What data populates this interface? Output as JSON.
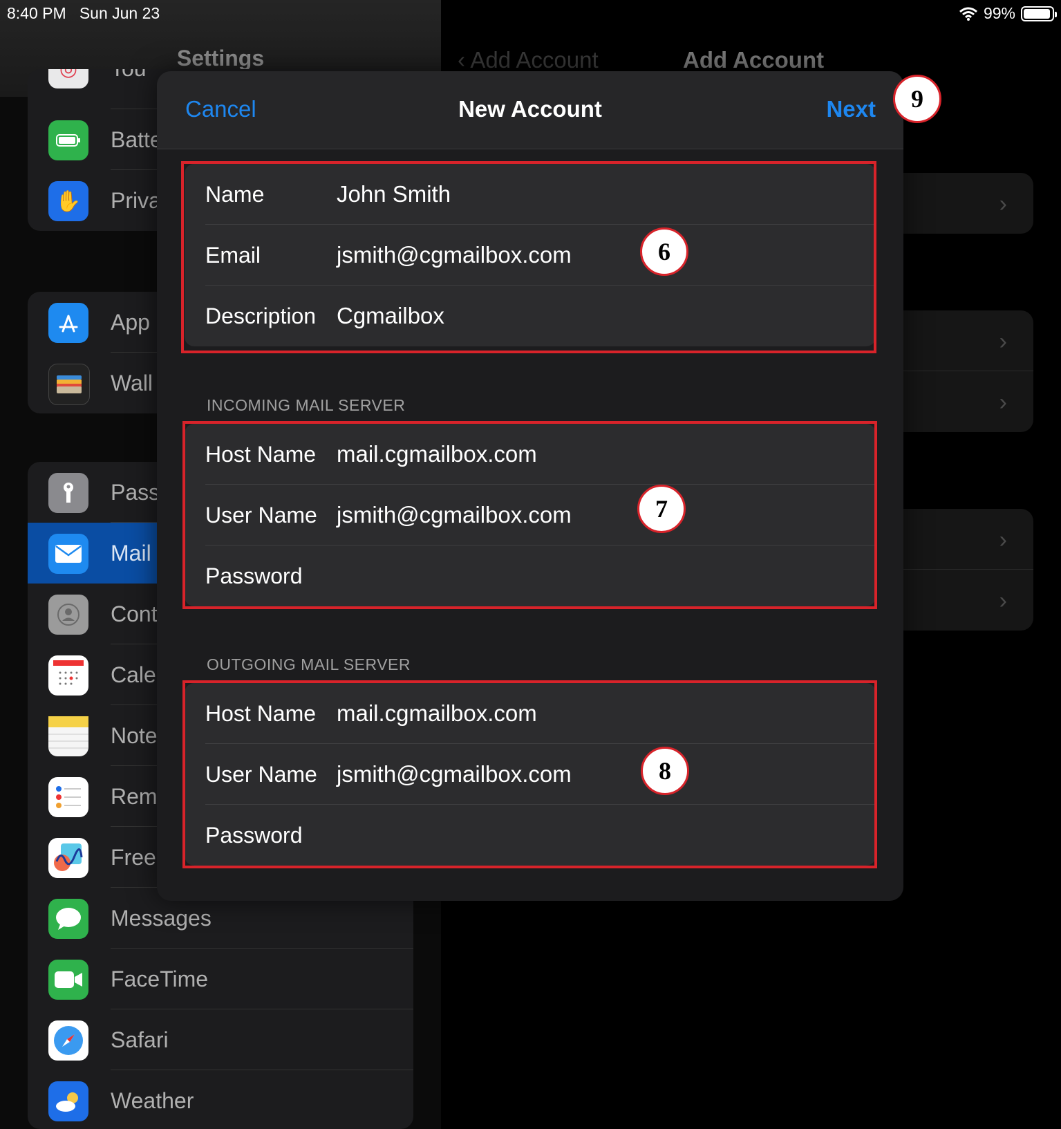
{
  "status": {
    "time": "8:40 PM",
    "date": "Sun Jun 23",
    "battery": "99%"
  },
  "sidebar": {
    "title": "Settings",
    "groups": [
      {
        "items": [
          {
            "label": "Tou",
            "icon": "touch-id-icon",
            "color": "#e04050"
          },
          {
            "label": "Batte",
            "icon": "battery-icon",
            "color": "#2fb24c"
          },
          {
            "label": "Priva",
            "icon": "hand-icon",
            "color": "#1e6ee8"
          }
        ]
      },
      {
        "items": [
          {
            "label": "App",
            "icon": "app-store-icon",
            "color": "#1e8af0"
          },
          {
            "label": "Wall",
            "icon": "wallet-icon",
            "color": "#222222"
          }
        ]
      },
      {
        "items": [
          {
            "label": "Pass",
            "icon": "key-icon",
            "color": "#8a8a8e"
          },
          {
            "label": "Mail",
            "icon": "mail-icon",
            "color": "#1e8af0"
          },
          {
            "label": "Cont",
            "icon": "contacts-icon",
            "color": "#9b9b9b"
          },
          {
            "label": "Cale",
            "icon": "calendar-icon",
            "color": "#ffffff"
          },
          {
            "label": "Note",
            "icon": "notes-icon",
            "color": "#f5d147"
          },
          {
            "label": "Rem",
            "icon": "reminders-icon",
            "color": "#ffffff"
          },
          {
            "label": "Free",
            "icon": "freeform-icon",
            "color": "#ffffff"
          },
          {
            "label": "Messages",
            "icon": "messages-icon",
            "color": "#2fb24c"
          },
          {
            "label": "FaceTime",
            "icon": "facetime-icon",
            "color": "#2fb24c"
          },
          {
            "label": "Safari",
            "icon": "safari-icon",
            "color": "#1e8af0"
          },
          {
            "label": "Weather",
            "icon": "weather-icon",
            "color": "#1e6ee8"
          }
        ]
      }
    ]
  },
  "detail": {
    "back_label": "Add Account",
    "title": "Add Account"
  },
  "modal": {
    "cancel": "Cancel",
    "title": "New Account",
    "next": "Next",
    "account": {
      "name_label": "Name",
      "name_value": "John Smith",
      "email_label": "Email",
      "email_value": "jsmith@cgmailbox.com",
      "description_label": "Description",
      "description_value": "Cgmailbox"
    },
    "incoming": {
      "header": "INCOMING MAIL SERVER",
      "host_label": "Host Name",
      "host_value": "mail.cgmailbox.com",
      "user_label": "User Name",
      "user_value": "jsmith@cgmailbox.com",
      "password_label": "Password",
      "password_value": ""
    },
    "outgoing": {
      "header": "OUTGOING MAIL SERVER",
      "host_label": "Host Name",
      "host_value": "mail.cgmailbox.com",
      "user_label": "User Name",
      "user_value": "jsmith@cgmailbox.com",
      "password_label": "Password",
      "password_value": ""
    }
  },
  "annotations": {
    "step_account": "6",
    "step_incoming": "7",
    "step_outgoing": "8",
    "step_next": "9",
    "color": "#d8232a"
  }
}
